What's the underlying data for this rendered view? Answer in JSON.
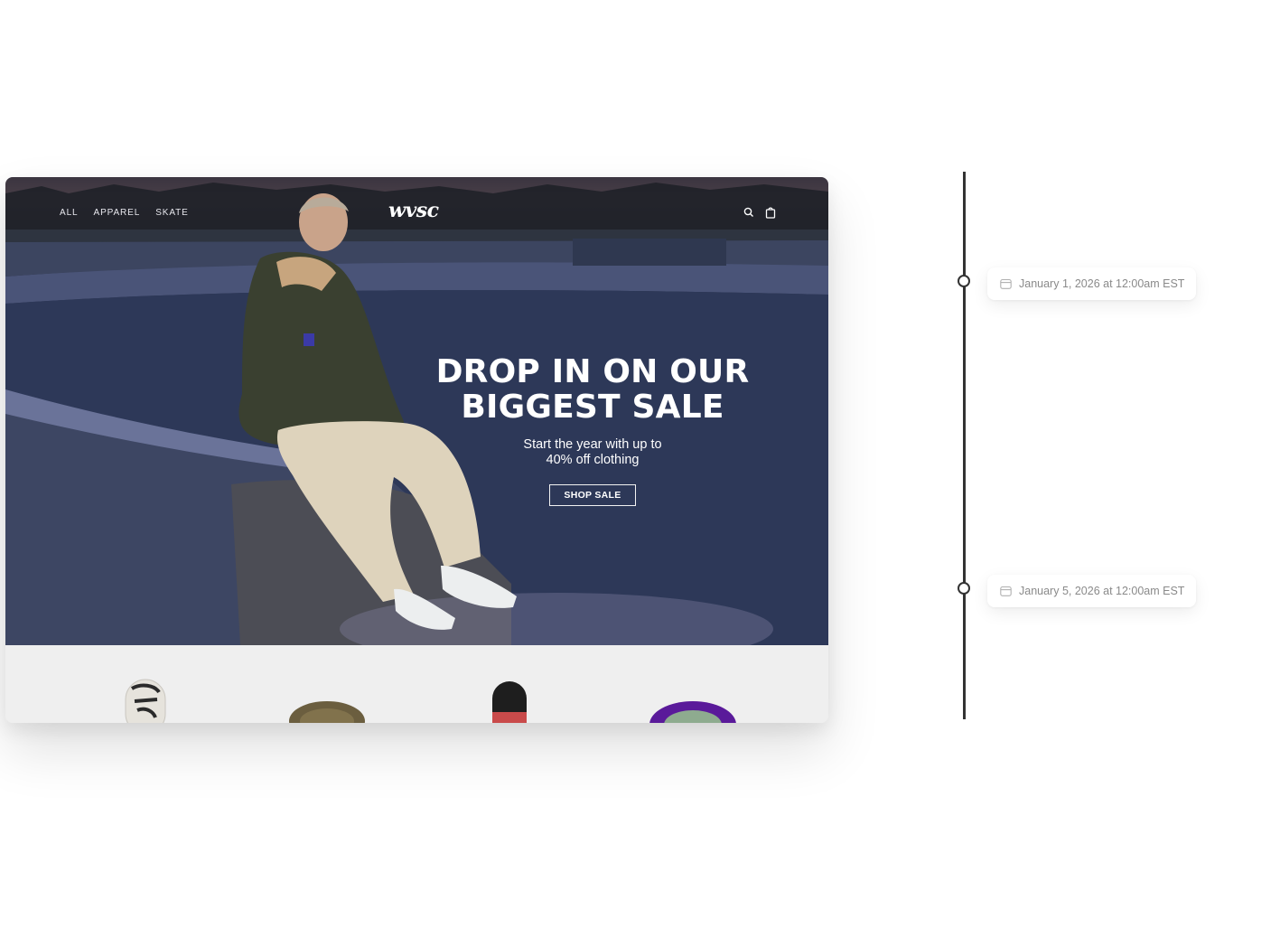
{
  "store": {
    "nav": {
      "links": [
        "ALL",
        "APPAREL",
        "SKATE"
      ],
      "logo": "wvsc",
      "icons": [
        "search-icon",
        "bag-icon"
      ]
    },
    "hero": {
      "headline": "DROP IN ON OUR BIGGEST SALE",
      "subline": "Start the year with up to\n40% off clothing",
      "cta": "SHOP SALE"
    }
  },
  "timeline": {
    "entries": [
      {
        "icon": "calendar-icon",
        "label": "January 1, 2026 at 12:00am EST"
      },
      {
        "icon": "calendar-icon",
        "label": "January 5, 2026 at 12:00am EST"
      }
    ]
  },
  "colors": {
    "timeline_line": "#333333",
    "hero_bg": "#2c3552",
    "product_strip_bg": "#efefef",
    "card_text": "#8a8a8a"
  }
}
